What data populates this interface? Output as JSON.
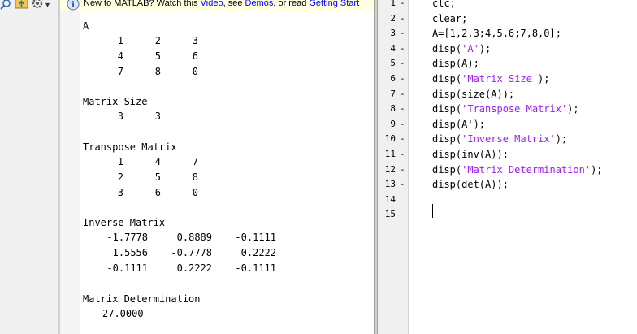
{
  "colors": {
    "string": "#a020f0",
    "link": "#0000ff",
    "info_bg": "#ffffe1",
    "gutter_bg": "#f0f0f0"
  },
  "toolbar": {
    "icons": [
      "search-icon",
      "folder-up-icon",
      "gear-icon"
    ],
    "gear_caret": "▾"
  },
  "info_bar": {
    "icon": "info-icon",
    "prefix": "New to MATLAB? Watch this ",
    "link_video": "Video",
    "middle": ", see ",
    "link_demos": "Demos",
    "middle2": ", or read ",
    "link_getting_started": "Getting Start"
  },
  "command_window": {
    "label_A": "A",
    "matrix_A": [
      [
        "1",
        "2",
        "3"
      ],
      [
        "4",
        "5",
        "6"
      ],
      [
        "7",
        "8",
        "0"
      ]
    ],
    "label_size": "Matrix Size",
    "size_values": [
      "3",
      "3"
    ],
    "label_transpose": "Transpose Matrix",
    "matrix_transpose": [
      [
        "1",
        "4",
        "7"
      ],
      [
        "2",
        "5",
        "8"
      ],
      [
        "3",
        "6",
        "0"
      ]
    ],
    "label_inverse": "Inverse Matrix",
    "matrix_inverse": [
      [
        "-1.7778",
        "0.8889",
        "-0.1111"
      ],
      [
        "1.5556",
        "-0.7778",
        "0.2222"
      ],
      [
        "-0.1111",
        "0.2222",
        "-0.1111"
      ]
    ],
    "label_det": "Matrix Determination",
    "det_value": "27.0000"
  },
  "editor": {
    "lines": [
      {
        "n": "1",
        "dash": "-",
        "code": [
          {
            "t": "clc;",
            "s": false
          }
        ]
      },
      {
        "n": "2",
        "dash": "-",
        "code": [
          {
            "t": "clear;",
            "s": false
          }
        ]
      },
      {
        "n": "3",
        "dash": "-",
        "code": [
          {
            "t": "A=[1,2,3;4,5,6;7,8,0];",
            "s": false
          }
        ]
      },
      {
        "n": "4",
        "dash": "-",
        "code": [
          {
            "t": "disp(",
            "s": false
          },
          {
            "t": "'A'",
            "s": true
          },
          {
            "t": ");",
            "s": false
          }
        ]
      },
      {
        "n": "5",
        "dash": "-",
        "code": [
          {
            "t": "disp(A);",
            "s": false
          }
        ]
      },
      {
        "n": "6",
        "dash": "-",
        "code": [
          {
            "t": "disp(",
            "s": false
          },
          {
            "t": "'Matrix Size'",
            "s": true
          },
          {
            "t": ");",
            "s": false
          }
        ]
      },
      {
        "n": "7",
        "dash": "-",
        "code": [
          {
            "t": "disp(size(A));",
            "s": false
          }
        ]
      },
      {
        "n": "8",
        "dash": "-",
        "code": [
          {
            "t": "disp(",
            "s": false
          },
          {
            "t": "'Transpose Matrix'",
            "s": true
          },
          {
            "t": ");",
            "s": false
          }
        ]
      },
      {
        "n": "9",
        "dash": "-",
        "code": [
          {
            "t": "disp(A');",
            "s": false
          }
        ]
      },
      {
        "n": "10",
        "dash": "-",
        "code": [
          {
            "t": "disp(",
            "s": false
          },
          {
            "t": "'Inverse Matrix'",
            "s": true
          },
          {
            "t": ");",
            "s": false
          }
        ]
      },
      {
        "n": "11",
        "dash": "-",
        "code": [
          {
            "t": "disp(inv(A));",
            "s": false
          }
        ]
      },
      {
        "n": "12",
        "dash": "-",
        "code": [
          {
            "t": "disp(",
            "s": false
          },
          {
            "t": "'Matrix Determination'",
            "s": true
          },
          {
            "t": ");",
            "s": false
          }
        ]
      },
      {
        "n": "13",
        "dash": "-",
        "code": [
          {
            "t": "disp(det(A));",
            "s": false
          }
        ]
      },
      {
        "n": "14",
        "dash": "",
        "code": []
      },
      {
        "n": "15",
        "dash": "",
        "code": []
      }
    ]
  }
}
